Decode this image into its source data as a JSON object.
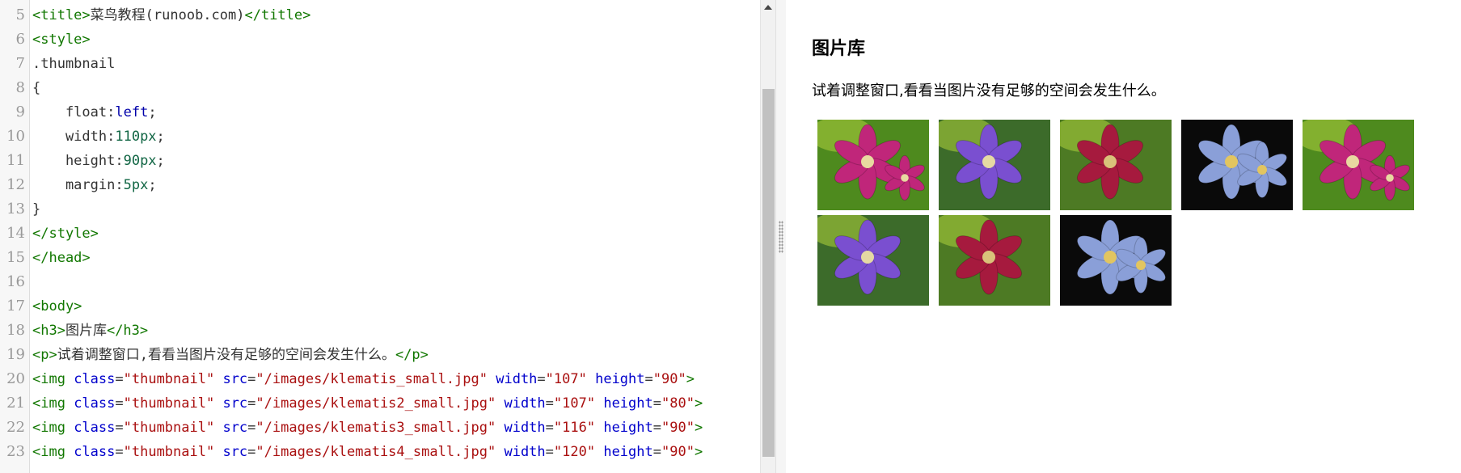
{
  "editor": {
    "lines": [
      {
        "n": "5",
        "html": "<span class=\"tag\">&lt;title&gt;</span><span class=\"plain\">菜鸟教程(runoob.com)</span><span class=\"tag\">&lt;/title&gt;</span>"
      },
      {
        "n": "6",
        "html": "<span class=\"tag\">&lt;style&gt;</span>"
      },
      {
        "n": "7",
        "html": "<span class=\"plain\">.thumbnail</span>"
      },
      {
        "n": "8",
        "html": "<span class=\"plain\">{</span>"
      },
      {
        "n": "9",
        "html": "<span class=\"plain\">    float:</span><span class=\"kw\">left</span><span class=\"plain\">;</span>"
      },
      {
        "n": "10",
        "html": "<span class=\"plain\">    width:</span><span class=\"num\">110px</span><span class=\"plain\">;</span>"
      },
      {
        "n": "11",
        "html": "<span class=\"plain\">    height:</span><span class=\"num\">90px</span><span class=\"plain\">;</span>"
      },
      {
        "n": "12",
        "html": "<span class=\"plain\">    margin:</span><span class=\"num\">5px</span><span class=\"plain\">;</span>"
      },
      {
        "n": "13",
        "html": "<span class=\"plain\">}</span>"
      },
      {
        "n": "14",
        "html": "<span class=\"tag\">&lt;/style&gt;</span>"
      },
      {
        "n": "15",
        "html": "<span class=\"tag\">&lt;/head&gt;</span>"
      },
      {
        "n": "16",
        "html": ""
      },
      {
        "n": "17",
        "html": "<span class=\"tag\">&lt;body&gt;</span>"
      },
      {
        "n": "18",
        "html": "<span class=\"tag\">&lt;h3&gt;</span><span class=\"plain\">图片库</span><span class=\"tag\">&lt;/h3&gt;</span>"
      },
      {
        "n": "19",
        "html": "<span class=\"tag\">&lt;p&gt;</span><span class=\"plain\">试着调整窗口,看看当图片没有足够的空间会发生什么。</span><span class=\"tag\">&lt;/p&gt;</span>"
      },
      {
        "n": "20",
        "html": "<span class=\"tag\">&lt;img </span><span class=\"attr\">class</span><span class=\"plain\">=</span><span class=\"str\">\"thumbnail\"</span><span class=\"attr\"> src</span><span class=\"plain\">=</span><span class=\"str\">\"/images/klematis_small.jpg\"</span><span class=\"attr\"> width</span><span class=\"plain\">=</span><span class=\"str\">\"107\"</span><span class=\"attr\"> height</span><span class=\"plain\">=</span><span class=\"str\">\"90\"</span><span class=\"tag\">&gt;</span>"
      },
      {
        "n": "21",
        "html": "<span class=\"tag\">&lt;img </span><span class=\"attr\">class</span><span class=\"plain\">=</span><span class=\"str\">\"thumbnail\"</span><span class=\"attr\"> src</span><span class=\"plain\">=</span><span class=\"str\">\"/images/klematis2_small.jpg\"</span><span class=\"attr\"> width</span><span class=\"plain\">=</span><span class=\"str\">\"107\"</span><span class=\"attr\"> height</span><span class=\"plain\">=</span><span class=\"str\">\"80\"</span><span class=\"tag\">&gt;</span>"
      },
      {
        "n": "22",
        "html": "<span class=\"tag\">&lt;img </span><span class=\"attr\">class</span><span class=\"plain\">=</span><span class=\"str\">\"thumbnail\"</span><span class=\"attr\"> src</span><span class=\"plain\">=</span><span class=\"str\">\"/images/klematis3_small.jpg\"</span><span class=\"attr\"> width</span><span class=\"plain\">=</span><span class=\"str\">\"116\"</span><span class=\"attr\"> height</span><span class=\"plain\">=</span><span class=\"str\">\"90\"</span><span class=\"tag\">&gt;</span>"
      },
      {
        "n": "23",
        "html": "<span class=\"tag\">&lt;img </span><span class=\"attr\">class</span><span class=\"plain\">=</span><span class=\"str\">\"thumbnail\"</span><span class=\"attr\"> src</span><span class=\"plain\">=</span><span class=\"str\">\"/images/klematis4_small.jpg\"</span><span class=\"attr\"> width</span><span class=\"plain\">=</span><span class=\"str\">\"120\"</span><span class=\"attr\"> height</span><span class=\"plain\">=</span><span class=\"str\">\"90\"</span><span class=\"tag\">&gt;</span>"
      }
    ]
  },
  "preview": {
    "heading": "图片库",
    "paragraph": "试着调整窗口,看看当图片没有足够的空间会发生什么。",
    "thumbnails": [
      {
        "name": "klematis-pink",
        "bg": "#4e8a1e",
        "petal": "#c0267a",
        "center": "#e8d9a0"
      },
      {
        "name": "klematis-purple",
        "bg": "#3c6b2a",
        "petal": "#7a4fd0",
        "center": "#e5d9a3"
      },
      {
        "name": "klematis-red",
        "bg": "#4d7a24",
        "petal": "#a61a3e",
        "center": "#d9c27a"
      },
      {
        "name": "klematis-blue",
        "bg": "#0a0a0a",
        "petal": "#8a9fd8",
        "center": "#e2c560"
      },
      {
        "name": "klematis-pink",
        "bg": "#4e8a1e",
        "petal": "#c0267a",
        "center": "#e8d9a0"
      },
      {
        "name": "klematis-purple",
        "bg": "#3c6b2a",
        "petal": "#7a4fd0",
        "center": "#e5d9a3"
      },
      {
        "name": "klematis-red",
        "bg": "#4d7a24",
        "petal": "#a61a3e",
        "center": "#d9c27a"
      },
      {
        "name": "klematis-blue",
        "bg": "#0a0a0a",
        "petal": "#8a9fd8",
        "center": "#e2c560"
      }
    ]
  },
  "colors": {
    "tag": "#117700",
    "attribute": "#0000cc",
    "string": "#aa1111",
    "number": "#116644",
    "keyword": "#0000aa"
  }
}
